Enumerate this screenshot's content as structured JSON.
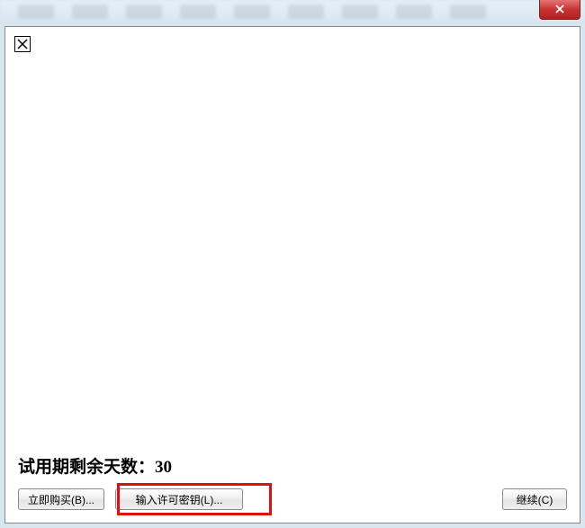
{
  "window": {
    "close_icon": "close-icon"
  },
  "dialog": {
    "trial_label": "试用期剩余天数：",
    "trial_days": "30",
    "buttons": {
      "buy_now": "立即购买(B)...",
      "enter_license": "输入许可密钥(L)...",
      "continue": "继续(C)"
    }
  }
}
